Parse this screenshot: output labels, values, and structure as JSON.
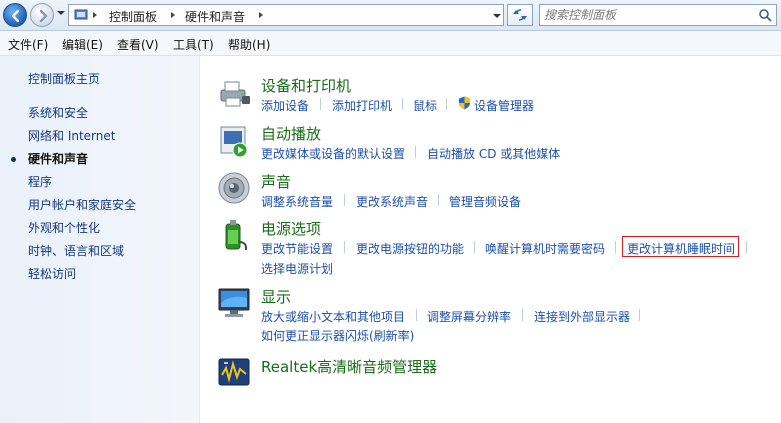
{
  "address": {
    "crumbs": [
      "控制面板",
      "硬件和声音"
    ],
    "search_placeholder": "搜索控制面板"
  },
  "menu": [
    "文件(F)",
    "编辑(E)",
    "查看(V)",
    "工具(T)",
    "帮助(H)"
  ],
  "sidebar": {
    "items": [
      {
        "label": "控制面板主页"
      },
      {
        "label": "系统和安全"
      },
      {
        "label": "网络和 Internet"
      },
      {
        "label": "硬件和声音",
        "active": true
      },
      {
        "label": "程序"
      },
      {
        "label": "用户帐户和家庭安全"
      },
      {
        "label": "外观和个性化"
      },
      {
        "label": "时钟、语言和区域"
      },
      {
        "label": "轻松访问"
      }
    ]
  },
  "categories": [
    {
      "title": "设备和打印机",
      "icon": "printer-icon",
      "links": [
        "添加设备",
        "添加打印机",
        "鼠标",
        "设备管理器"
      ]
    },
    {
      "title": "自动播放",
      "icon": "autoplay-icon",
      "links": [
        "更改媒体或设备的默认设置",
        "自动播放 CD 或其他媒体"
      ]
    },
    {
      "title": "声音",
      "icon": "speaker-icon",
      "links": [
        "调整系统音量",
        "更改系统声音",
        "管理音频设备"
      ]
    },
    {
      "title": "电源选项",
      "icon": "power-icon",
      "links": [
        "更改节能设置",
        "更改电源按钮的功能",
        "唤醒计算机时需要密码",
        "更改计算机睡眠时间",
        "选择电源计划"
      ],
      "highlighted_link": "更改计算机睡眠时间"
    },
    {
      "title": "显示",
      "icon": "monitor-icon",
      "links": [
        "放大或缩小文本和其他项目",
        "调整屏幕分辨率",
        "连接到外部显示器",
        "如何更正显示器闪烁(刷新率)"
      ]
    },
    {
      "title": "Realtek高清晰音频管理器",
      "icon": "realtek-icon",
      "links": []
    }
  ],
  "colors": {
    "title_green": "#1a6b1a",
    "link_blue": "#1d4fa8",
    "highlight_red": "#d51e1e"
  }
}
